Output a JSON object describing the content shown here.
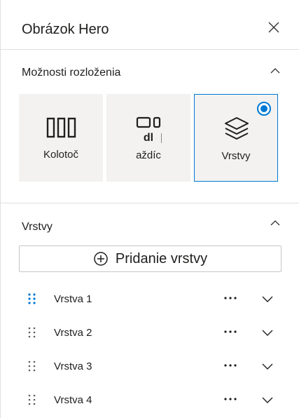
{
  "panel": {
    "title": "Obrázok Hero",
    "close_icon": "close-icon"
  },
  "layout_section": {
    "title": "Možnosti rozloženia",
    "options": [
      {
        "label": "Kolotoč",
        "icon": "carousel-icon",
        "selected": false
      },
      {
        "label": "Dlaždice",
        "visible_text_line1": "dl",
        "visible_text_line2": "aždíc",
        "icon": "tiles-icon",
        "selected": false
      },
      {
        "label": "Vrstvy",
        "icon": "layers-icon",
        "selected": true
      }
    ]
  },
  "layers_section": {
    "title": "Vrstvy",
    "add_button_label": "Pridanie vrstvy",
    "layers": [
      {
        "label": "Vrstva 1",
        "active": true
      },
      {
        "label": "Vrstva 2",
        "active": false
      },
      {
        "label": "Vrstva 3",
        "active": false
      },
      {
        "label": "Vrstva 4",
        "active": false
      }
    ]
  },
  "colors": {
    "accent": "#0078d4",
    "tile_bg": "#f3f2f1",
    "divider": "#e1dfdd",
    "text": "#201f1e"
  }
}
